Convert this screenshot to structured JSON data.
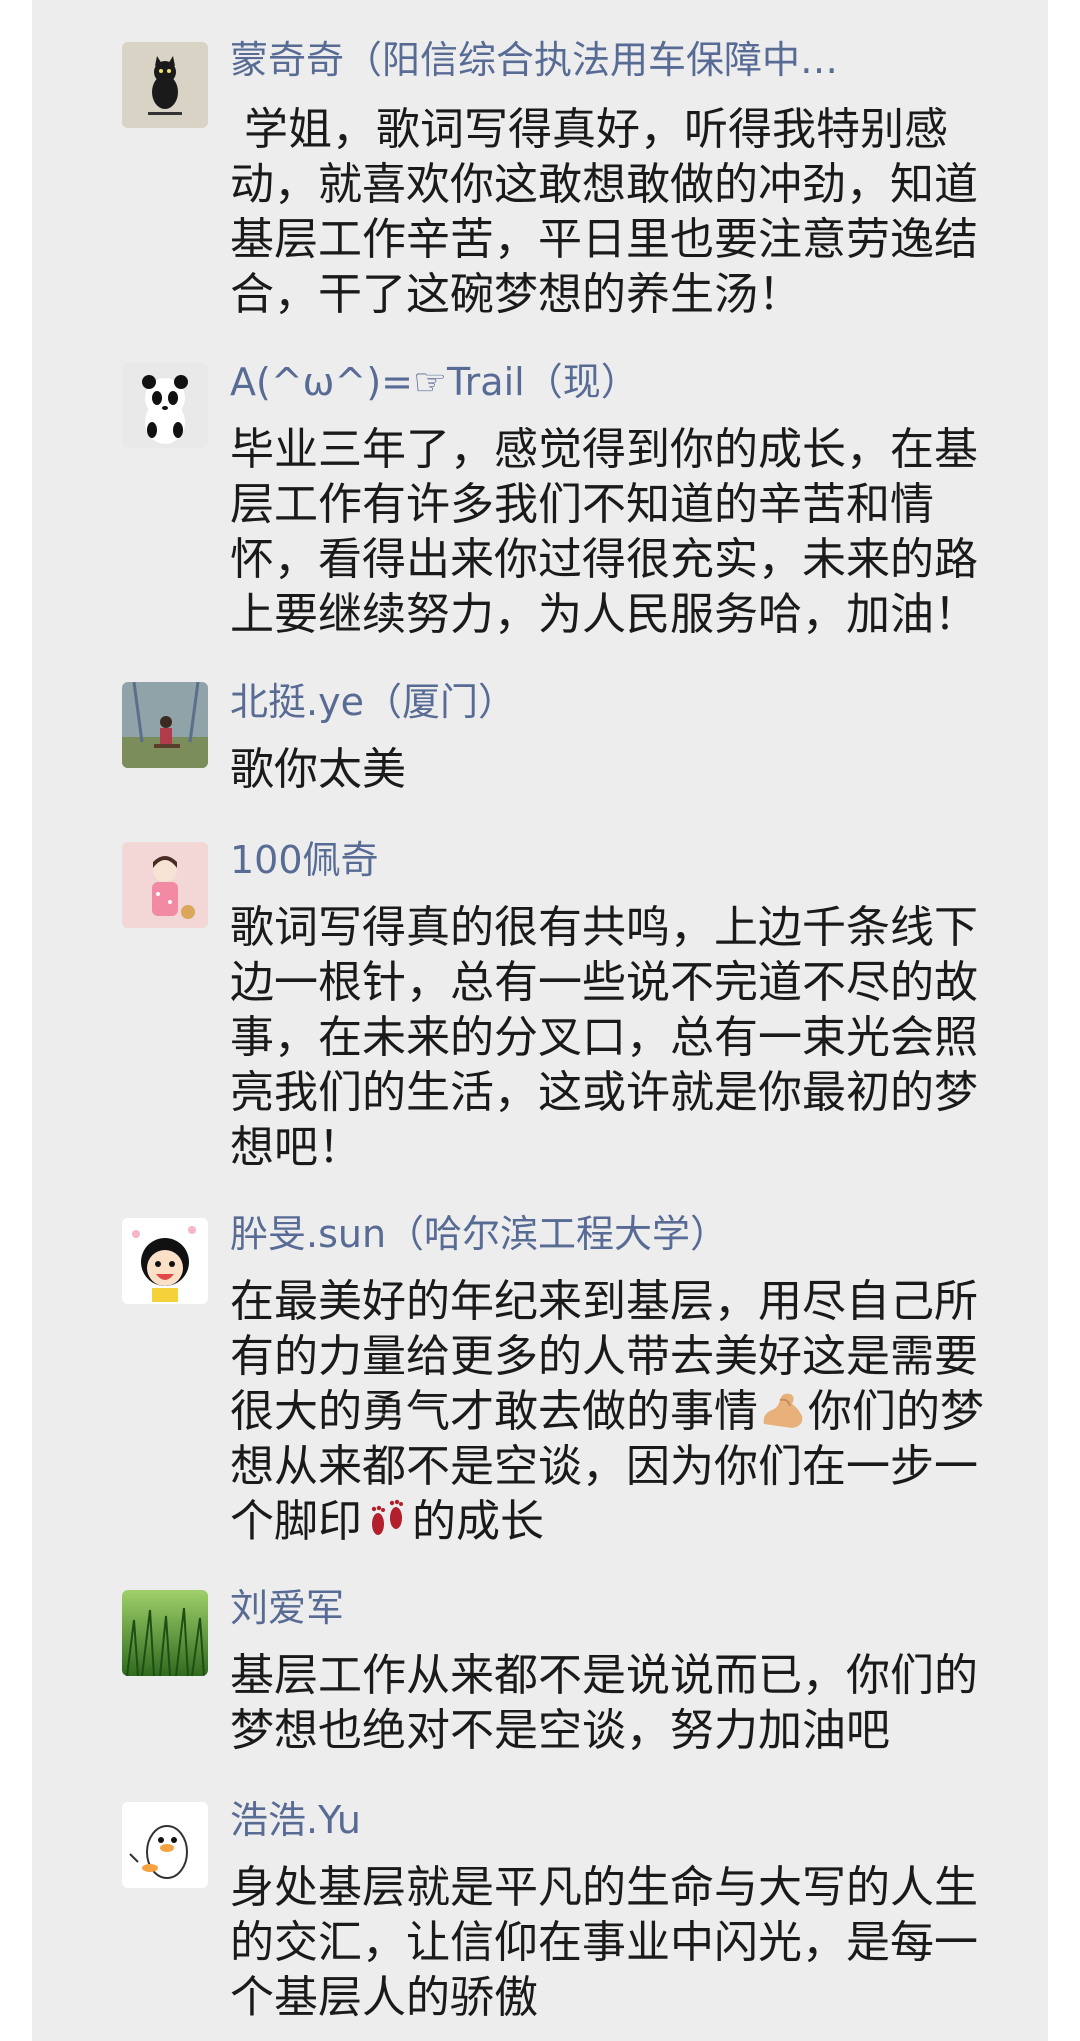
{
  "comments": [
    {
      "name": "蒙奇奇（阳信综合执法用车保障中…",
      "avatar_icon": "black-cat-avatar",
      "text": " 学姐，歌词写得真好，听得我特别感动，就喜欢你这敢想敢做的冲劲，知道基层工作辛苦，平日里也要注意劳逸结合，干了这碗梦想的养生汤！"
    },
    {
      "name": "A(^ω^)=☞Trail（现）",
      "avatar_icon": "panda-avatar",
      "text": "毕业三年了，感觉得到你的成长，在基层工作有许多我们不知道的辛苦和情怀，看得出来你过得很充实，未来的路上要继续努力，为人民服务哈，加油！"
    },
    {
      "name": "北挺.ye（厦门）",
      "avatar_icon": "child-swing-avatar",
      "text": "歌你太美"
    },
    {
      "name": "100佩奇",
      "avatar_icon": "cartoon-girl-avatar",
      "text": "歌词写得真的很有共鸣，上边千条线下边一根针，总有一些说不完道不尽的故事，在未来的分叉口，总有一束光会照亮我们的生活，这或许就是你最初的梦想吧！"
    },
    {
      "name": "肸旻.sun（哈尔滨工程大学）",
      "avatar_icon": "cartoon-face-avatar",
      "text_a": "在最美好的年纪来到基层，用尽自己所有的力量给更多的人带去美好这是需要很大的勇气才敢去做的事情",
      "emoji_1": "flexed-biceps-icon",
      "text_b": "你们的梦想从来都不是空谈，因为你们在一步一个脚印",
      "emoji_2": "footprints-icon",
      "text_c": "的成长"
    },
    {
      "name": "刘爱军",
      "avatar_icon": "grass-avatar",
      "text": "基层工作从来都不是说说而已，你们的梦想也绝对不是空谈，努力加油吧"
    },
    {
      "name": "浩浩.Yu",
      "avatar_icon": "duck-avatar",
      "text": "身处基层就是平凡的生命与大写的人生的交汇，让信仰在事业中闪光，是每一个基层人的骄傲"
    }
  ]
}
